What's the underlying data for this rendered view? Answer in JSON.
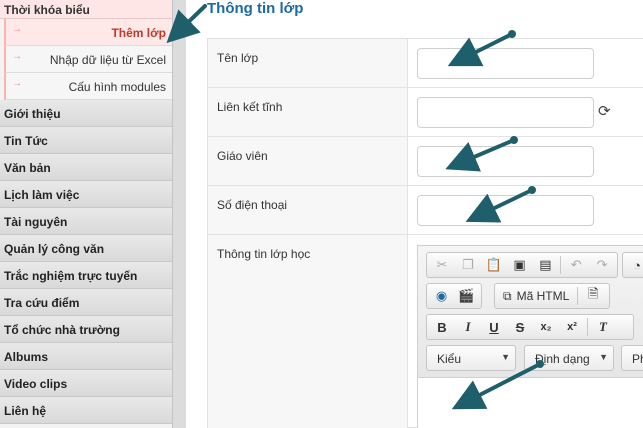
{
  "sidebar": {
    "header": "Thời khóa biểu",
    "sub_items": [
      {
        "label": "Thêm lớp",
        "active": true
      },
      {
        "label": "Nhập dữ liệu từ Excel",
        "active": false
      },
      {
        "label": "Cấu hình modules",
        "active": false
      }
    ],
    "items": [
      {
        "label": "Giới thiệu"
      },
      {
        "label": "Tin Tức"
      },
      {
        "label": "Văn bản"
      },
      {
        "label": "Lịch làm việc"
      },
      {
        "label": "Tài nguyên"
      },
      {
        "label": "Quản lý công văn"
      },
      {
        "label": "Trắc nghiệm trực tuyến"
      },
      {
        "label": "Tra cứu điểm"
      },
      {
        "label": "Tổ chức nhà trường"
      },
      {
        "label": "Albums"
      },
      {
        "label": "Video clips"
      },
      {
        "label": "Liên hệ"
      }
    ]
  },
  "main": {
    "title": "Thông tin lớp",
    "fields": {
      "ten_lop": {
        "label": "Tên lớp",
        "value": ""
      },
      "lien_ket_tinh": {
        "label": "Liên kết tĩnh",
        "value": ""
      },
      "giao_vien": {
        "label": "Giáo viên",
        "value": ""
      },
      "so_dien_thoai": {
        "label": "Số điện thoại",
        "value": ""
      },
      "thong_tin_lop_hoc": {
        "label": "Thông tin lớp học"
      }
    },
    "editor": {
      "source_label": "Mã HTML",
      "style_combo": "Kiểu",
      "format_combo": "Định dạng",
      "font_combo_partial": "Ph",
      "icons": [
        "cut-icon",
        "copy-icon",
        "paste-icon",
        "paste-text-icon",
        "paste-word-icon",
        "undo-icon",
        "redo-icon",
        "image-icon",
        "flash-icon",
        "source-icon",
        "template-icon",
        "remove-format-icon",
        "refresh-icon"
      ],
      "format_buttons": {
        "bold": "B",
        "italic": "I",
        "underline": "U",
        "strike": "S",
        "subscript": "x₂",
        "superscript": "x²",
        "remove_format": "T"
      }
    }
  },
  "colors": {
    "title": "#1b6aa5",
    "active_item": "#c0392b",
    "arrow": "#1e5f6b",
    "header_bg": "#ffe6e6"
  }
}
